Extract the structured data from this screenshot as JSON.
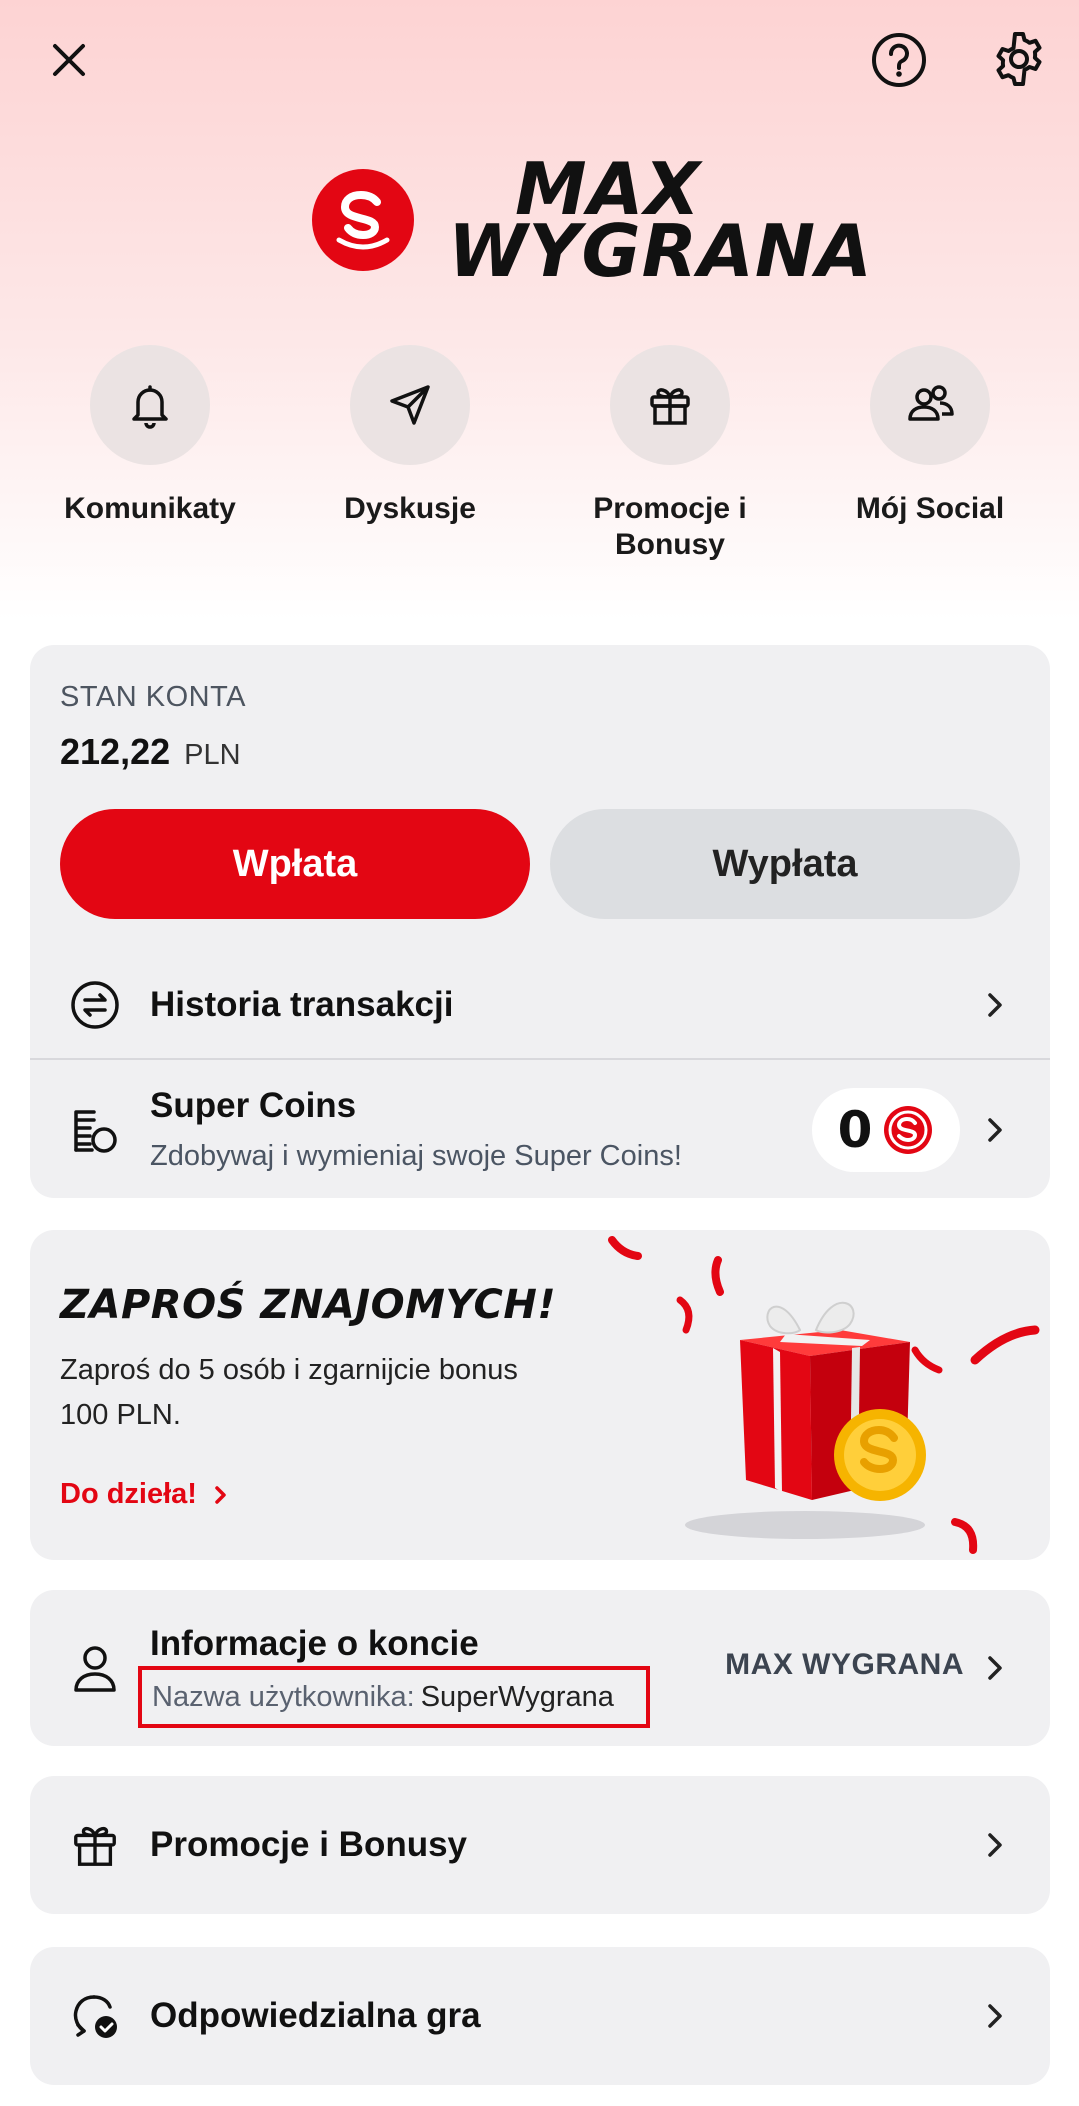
{
  "brand": {
    "name_line1": "MAX",
    "name_line2": "WYGRANA"
  },
  "quick_actions": [
    {
      "label": "Komunikaty",
      "icon": "bell-icon"
    },
    {
      "label": "Dyskusje",
      "icon": "send-icon"
    },
    {
      "label": "Promocje i Bonusy",
      "icon": "gift-icon"
    },
    {
      "label": "Mój Social",
      "icon": "users-icon"
    }
  ],
  "balance": {
    "label": "STAN KONTA",
    "amount": "212,22",
    "currency": "PLN",
    "deposit_label": "Wpłata",
    "withdraw_label": "Wypłata"
  },
  "history": {
    "title": "Historia transakcji"
  },
  "super_coins": {
    "title": "Super Coins",
    "subtitle": "Zdobywaj i wymieniaj swoje Super Coins!",
    "value": "0"
  },
  "invite": {
    "title": "ZAPROŚ ZNAJOMYCH!",
    "text": "Zaproś do 5 osób i zgarnijcie bonus 100 PLN.",
    "link": "Do dzieła!"
  },
  "account": {
    "title": "Informacje o koncie",
    "username_label": "Nazwa użytkownika:",
    "username_value": "SuperWygrana",
    "right_label": "MAX WYGRANA"
  },
  "promotions": {
    "title": "Promocje i Bonusy"
  },
  "responsible": {
    "title": "Odpowiedzialna gra"
  },
  "colors": {
    "accent": "#e30613",
    "card_bg": "#f0f0f2",
    "header_gradient_top": "#fdd3d3"
  }
}
